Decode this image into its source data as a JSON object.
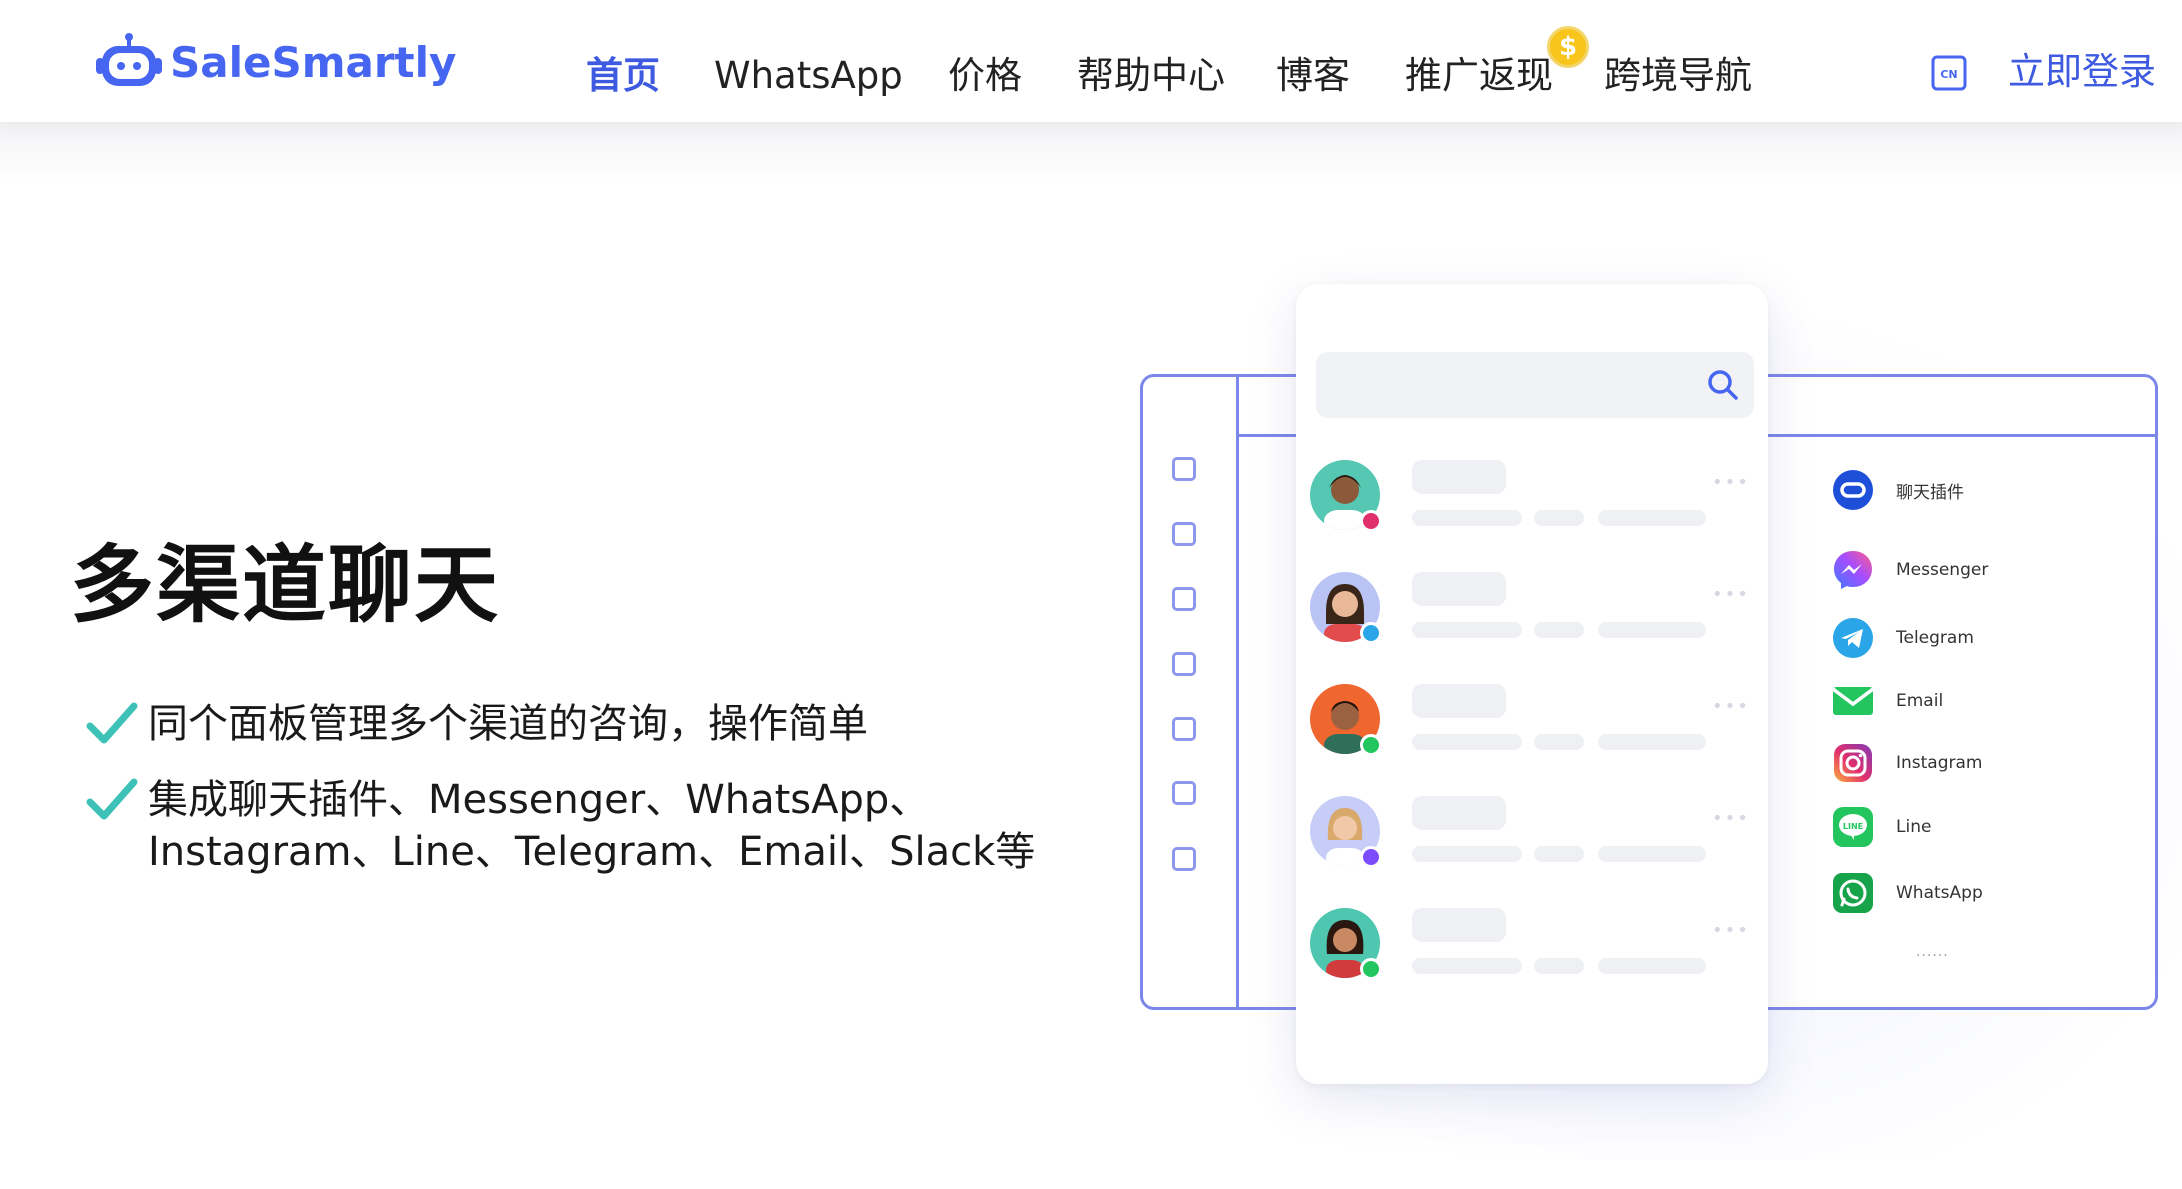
{
  "header": {
    "logo_text": "SaleSmartly",
    "nav": [
      {
        "label": "首页",
        "active": true
      },
      {
        "label": "WhatsApp",
        "active": false
      },
      {
        "label": "价格",
        "active": false
      },
      {
        "label": "帮助中心",
        "active": false
      },
      {
        "label": "博客",
        "active": false
      },
      {
        "label": "推广返现",
        "active": false
      },
      {
        "label": "跨境导航",
        "active": false
      }
    ],
    "coin_badge": "$",
    "language_icon": "CN",
    "login_label": "立即登录"
  },
  "hero": {
    "title": "多渠道聊天",
    "features": [
      "同个面板管理多个渠道的咨询，操作简单",
      "集成聊天插件、Messenger、WhatsApp、\nInstagram、Line、Telegram、Email、Slack等"
    ]
  },
  "illustration": {
    "channels": [
      {
        "label": "聊天插件",
        "icon": "chat-plugin-icon",
        "color": "#1d4fd8"
      },
      {
        "label": "Messenger",
        "icon": "messenger-icon",
        "color": "#7b4dff"
      },
      {
        "label": "Telegram",
        "icon": "telegram-icon",
        "color": "#2aa6e8"
      },
      {
        "label": "Email",
        "icon": "email-icon",
        "color": "#22c55e"
      },
      {
        "label": "Instagram",
        "icon": "instagram-icon",
        "color": "#e1306c"
      },
      {
        "label": "Line",
        "icon": "line-icon",
        "color": "#22c55e"
      },
      {
        "label": "WhatsApp",
        "icon": "whatsapp-icon",
        "color": "#16a34a"
      }
    ],
    "more": "......"
  },
  "colors": {
    "brand": "#4665f0",
    "accent_check": "#3ec2b8",
    "frame": "#7c88e8"
  }
}
